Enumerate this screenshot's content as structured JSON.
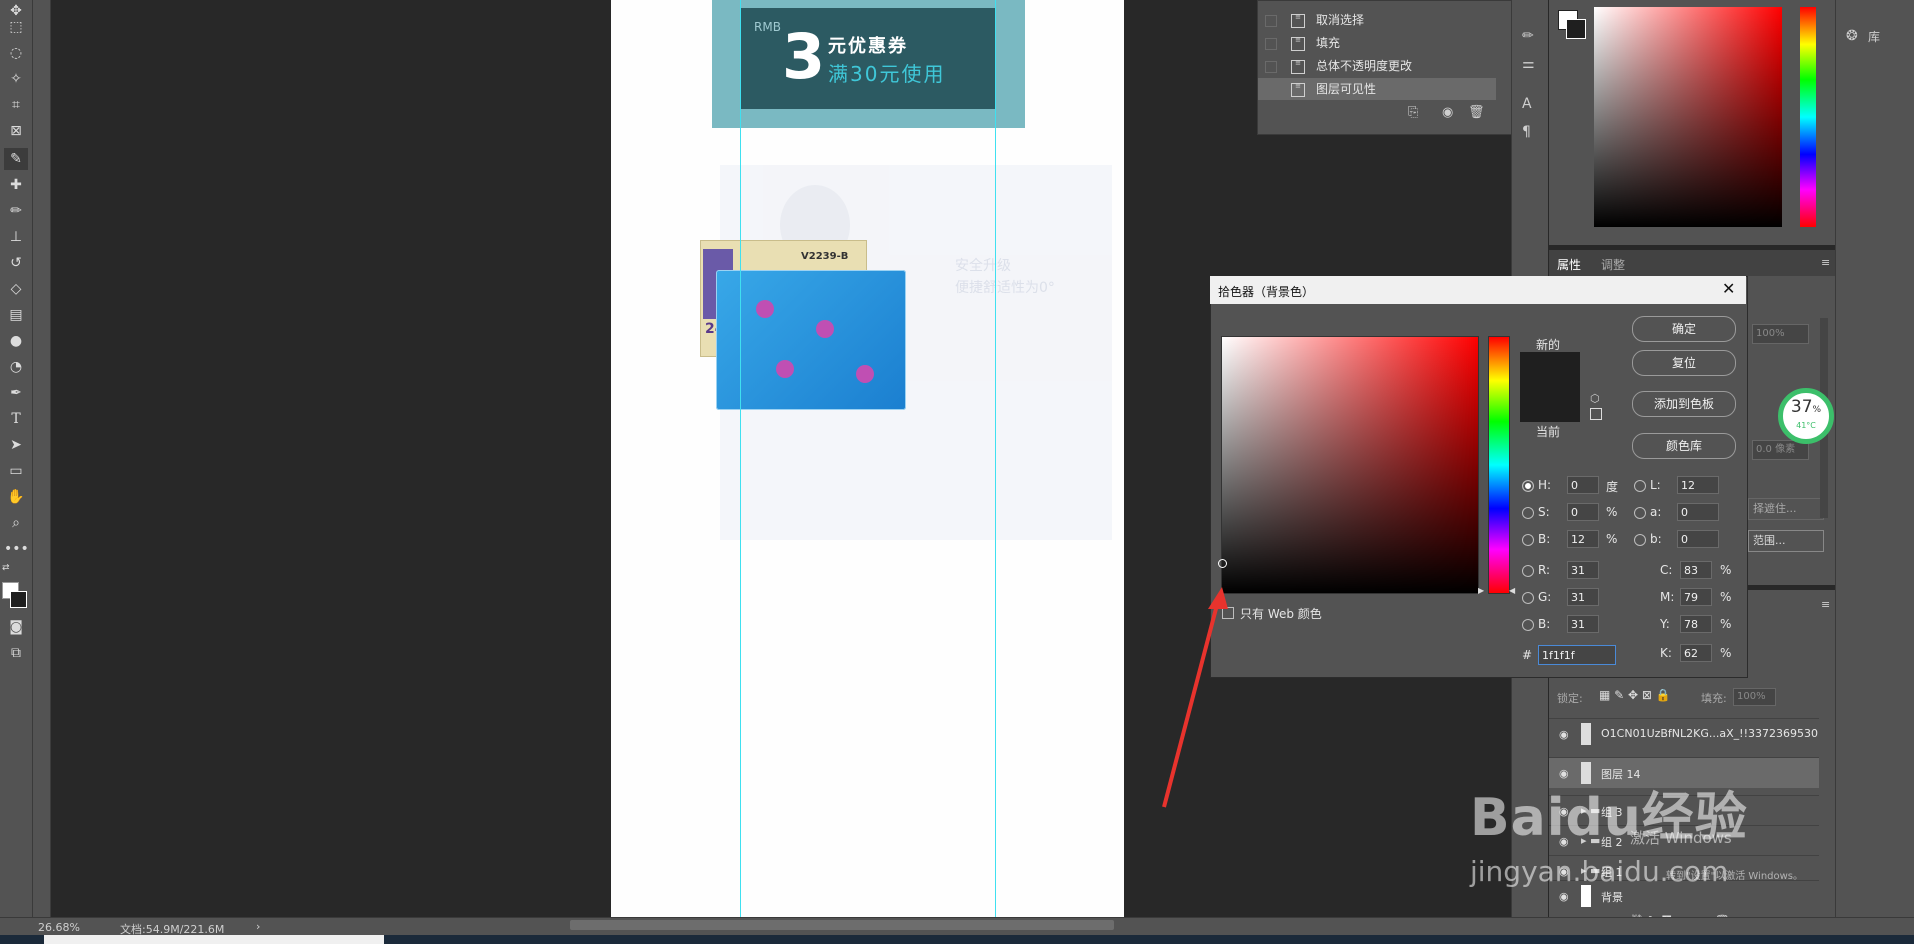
{
  "toolbar": {
    "tools": [
      "move-tool",
      "marquee-tool",
      "lasso-tool",
      "magic-wand-tool",
      "crop-tool",
      "frame-tool",
      "eyedropper-tool",
      "healing-brush-tool",
      "brush-tool",
      "clone-stamp-tool",
      "history-brush-tool",
      "eraser-tool",
      "gradient-tool",
      "blur-tool",
      "dodge-tool",
      "pen-tool",
      "type-tool",
      "path-selection-tool",
      "rectangle-tool",
      "hand-tool",
      "zoom-tool",
      "more-tools"
    ]
  },
  "canvas": {
    "coupon": {
      "currency": "RMB",
      "amount": "3",
      "label": "元优惠券",
      "condition": "满30元使用"
    },
    "faded_text": {
      "line1": "安全升级",
      "line2": "便捷舒适性为0°"
    },
    "product_tag": {
      "model": "V2239-B",
      "count": "24×S"
    }
  },
  "history_panel": {
    "items": [
      {
        "label": "取消选择"
      },
      {
        "label": "填充"
      },
      {
        "label": "总体不透明度更改"
      },
      {
        "label": "图层可见性"
      }
    ]
  },
  "right_strip": {
    "library_label": "库"
  },
  "properties_panel": {
    "tabs": [
      {
        "label": "属性"
      },
      {
        "label": "调整"
      }
    ],
    "opacity_partial": "100%",
    "pixels_partial": "0.0 像素",
    "range_button": "范围...",
    "select_partial": "择遮住..."
  },
  "temperature_widget": {
    "percent": "37",
    "percent_unit": "%",
    "temp": "41°C"
  },
  "color_picker_dialog": {
    "title": "拾色器（背景色）",
    "buttons": {
      "ok": "确定",
      "reset": "复位",
      "add_swatch": "添加到色板",
      "color_library": "颜色库"
    },
    "new_label": "新的",
    "current_label": "当前",
    "web_only_label": "只有 Web 颜色",
    "fields": {
      "H": {
        "label": "H:",
        "value": "0",
        "unit": "度"
      },
      "S": {
        "label": "S:",
        "value": "0",
        "unit": "%"
      },
      "Bv": {
        "label": "B:",
        "value": "12",
        "unit": "%"
      },
      "R": {
        "label": "R:",
        "value": "31"
      },
      "G": {
        "label": "G:",
        "value": "31"
      },
      "Bc": {
        "label": "B:",
        "value": "31"
      },
      "L": {
        "label": "L:",
        "value": "12"
      },
      "a": {
        "label": "a:",
        "value": "0"
      },
      "b": {
        "label": "b:",
        "value": "0"
      },
      "C": {
        "label": "C:",
        "value": "83",
        "unit": "%"
      },
      "M": {
        "label": "M:",
        "value": "79",
        "unit": "%"
      },
      "Y": {
        "label": "Y:",
        "value": "78",
        "unit": "%"
      },
      "K": {
        "label": "K:",
        "value": "62",
        "unit": "%"
      }
    },
    "hex_label": "#",
    "hex_value": "1f1f1f",
    "new_color": "#1f1f1f",
    "current_color": "#1f1f1f"
  },
  "layers_panel": {
    "lock_label": "锁定:",
    "fill_label": "填充:",
    "fill_value": "100%",
    "layers": [
      {
        "name": "O1CN01UzBfNL2KG...aX_!!3372369530"
      },
      {
        "name": "图层 14"
      },
      {
        "name": "组 3"
      },
      {
        "name": "组 2"
      },
      {
        "name": "组 1"
      },
      {
        "name": "背景"
      }
    ]
  },
  "status_bar": {
    "zoom": "26.68%",
    "doc_size": "文档:54.9M/221.6M"
  },
  "watermark": {
    "brand": "Baidu经验",
    "url": "jingyan.baidu.com",
    "activate_text": "激活 Windows",
    "activate_sub": "转到\"设置\"以激活 Windows。"
  }
}
